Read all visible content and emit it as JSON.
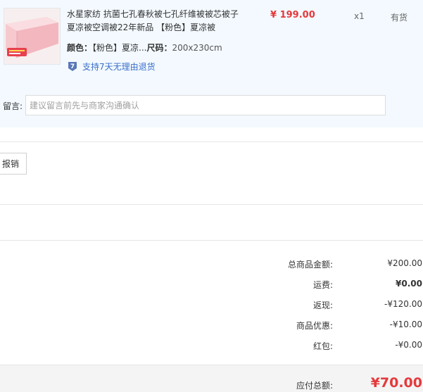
{
  "product": {
    "title": "水星家纺 抗菌七孔春秋被七孔纤维被被芯被子夏凉被空调被22年新品 【粉色】夏凉被",
    "price": "¥ 199.00",
    "quantity": "x1",
    "stock_status": "有货",
    "color_label": "颜色：",
    "color_value": "【粉色】夏凉...",
    "size_label": "尺码：",
    "size_value": "200x230cm",
    "return_policy": "支持7天无理由退货",
    "return_icon_glyph": "7"
  },
  "remark": {
    "label": "留言:",
    "placeholder": "建议留言前先与商家沟通确认"
  },
  "invoice": {
    "button_label": "报销"
  },
  "totals": {
    "rows": [
      {
        "label": "总商品金额:",
        "value": "¥200.00"
      },
      {
        "label": "运费:",
        "value": "¥0.00"
      },
      {
        "label": "返现:",
        "value": "-¥120.00"
      },
      {
        "label": "商品优惠:",
        "value": "-¥10.00"
      },
      {
        "label": "红包:",
        "value": "-¥0.00"
      }
    ],
    "grand_label": "应付总额:",
    "grand_value": "¥70.00"
  },
  "colors": {
    "price_red": "#e4393c",
    "link_blue": "#3a6ec8",
    "product_bg": "#f3f9ff",
    "return_icon": "#5a78b8"
  },
  "icons": {
    "return": "seven-day-return-icon",
    "thumb": "pink-quilt-thumbnail"
  }
}
